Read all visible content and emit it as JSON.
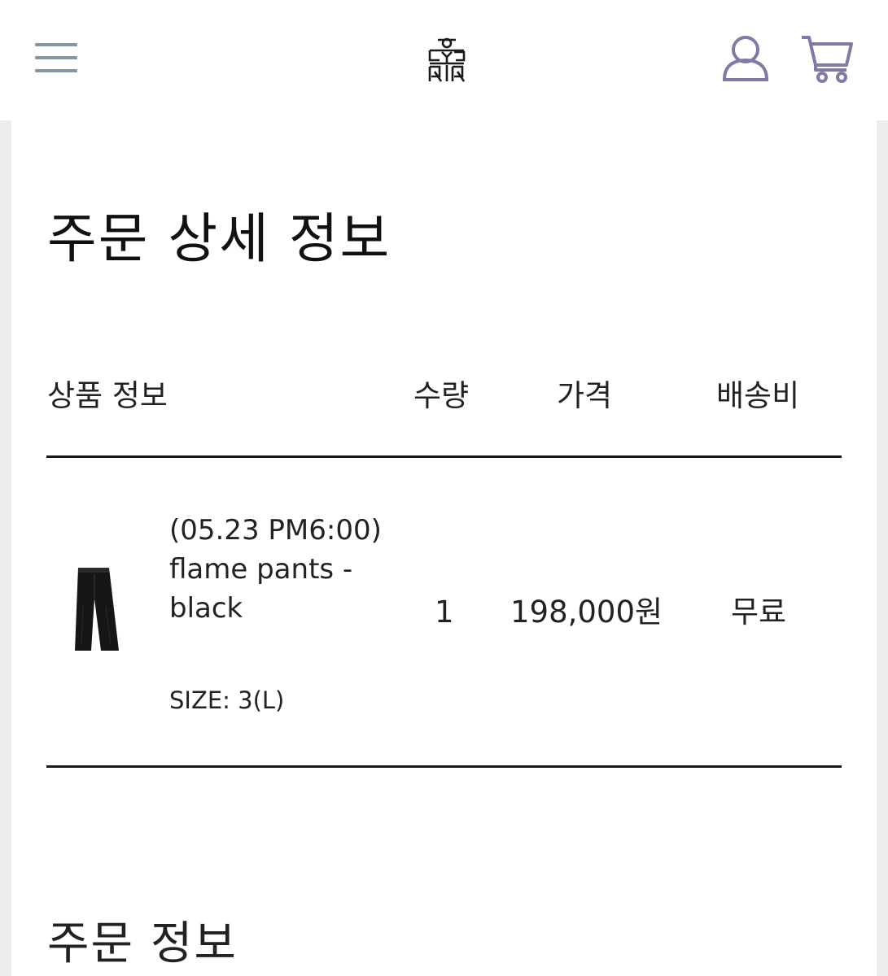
{
  "header": {
    "menu_icon": "hamburger-menu-icon",
    "logo_icon": "brand-logo-icon",
    "account_icon": "user-icon",
    "cart_icon": "shopping-cart-icon",
    "icon_color": "#7f7aa6",
    "menu_color": "#8a93a6"
  },
  "page": {
    "title": "주문 상세 정보"
  },
  "table": {
    "headers": {
      "product": "상품 정보",
      "quantity": "수량",
      "price": "가격",
      "shipping": "배송비"
    },
    "rows": [
      {
        "name": "(05.23 PM6:00) flame pants - black",
        "option": "SIZE: 3(L)",
        "quantity": "1",
        "price": "198,000원",
        "shipping": "무료"
      }
    ]
  },
  "order_info": {
    "title": "주문 정보"
  }
}
